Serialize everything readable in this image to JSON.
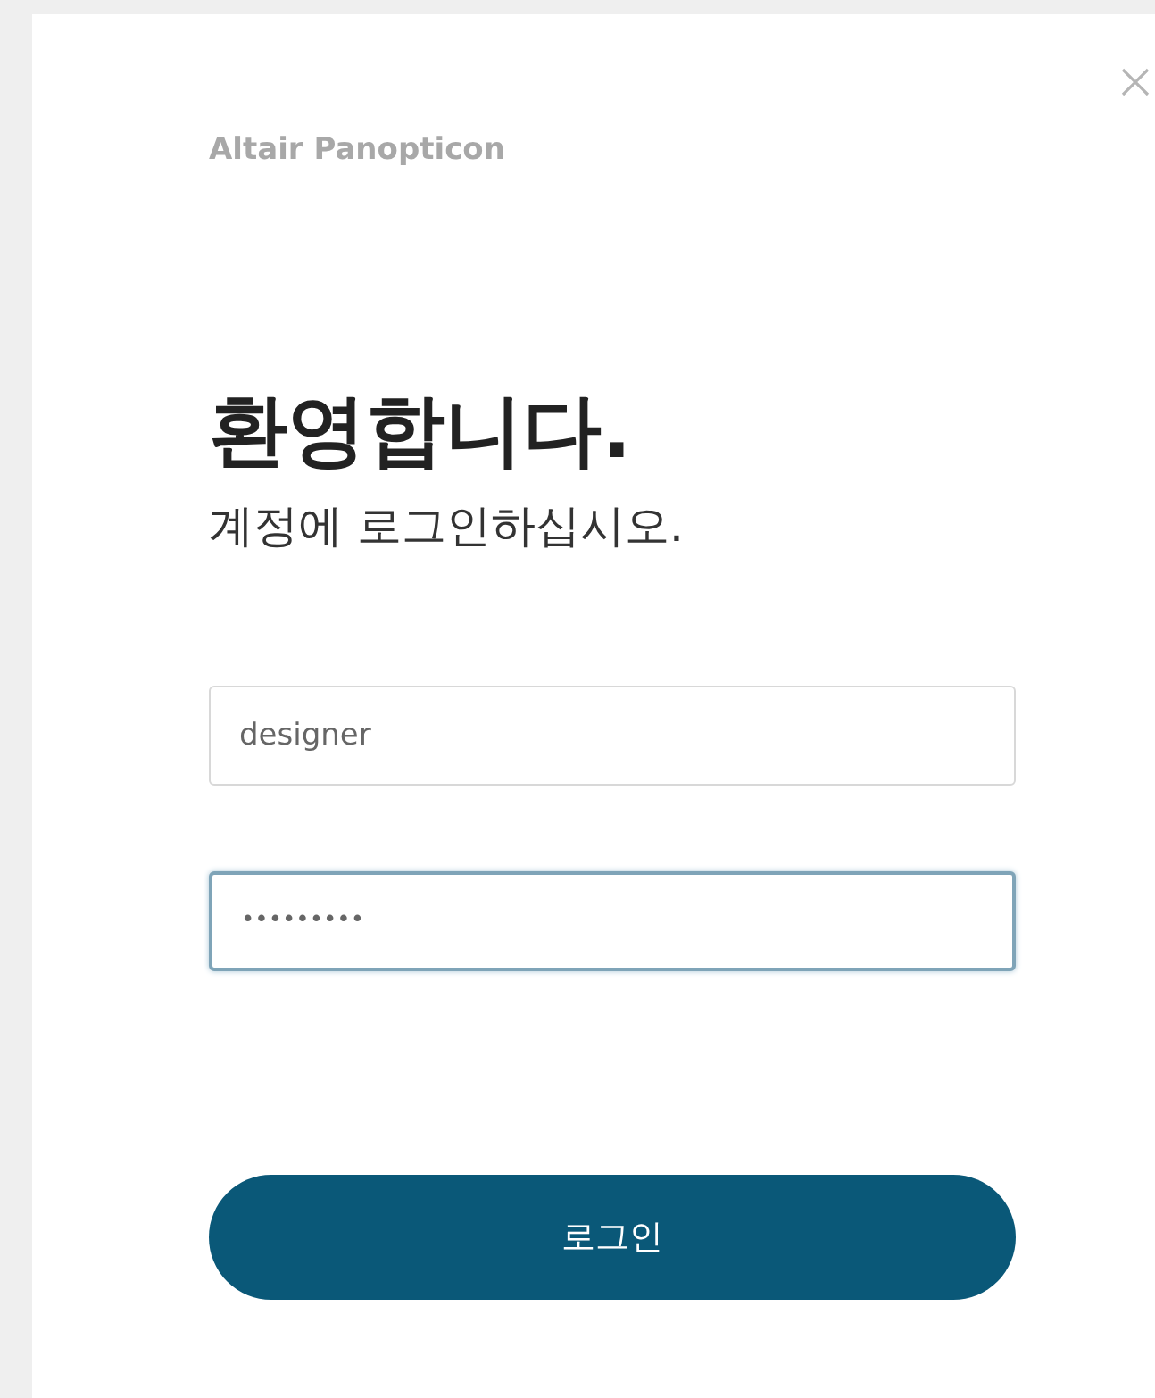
{
  "brand": "Altair Panopticon",
  "title": "환영합니다.",
  "subtitle": "계정에 로그인하십시오.",
  "fields": [
    {
      "kind": "text",
      "value": "designer",
      "focused": false
    },
    {
      "kind": "password",
      "value": "•••••••••",
      "focused": true
    }
  ],
  "button": "로그인"
}
